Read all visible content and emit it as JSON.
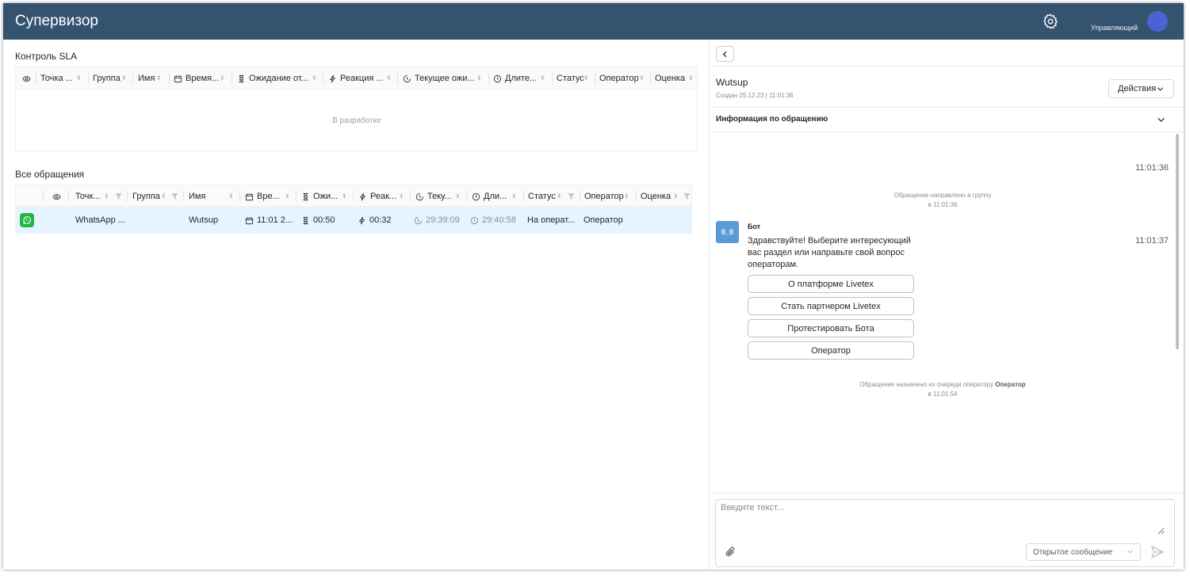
{
  "header": {
    "title": "Супервизор",
    "role": "Управляющий"
  },
  "sla": {
    "title": "Контроль SLA",
    "columns": [
      "Точка ...",
      "Группа",
      "Имя",
      "Время...",
      "Ожидание от...",
      "Реакция ...",
      "Текущее ожи...",
      "Длите...",
      "Статус",
      "Оператор",
      "Оценка"
    ],
    "empty_text": "В разработке"
  },
  "all": {
    "title": "Все обращения",
    "columns": [
      "Точк...",
      "Группа",
      "Имя",
      "Вре...",
      "Ожи...",
      "Реак...",
      "Теку...",
      "Дли...",
      "Статус",
      "Оператор",
      "Оценка"
    ],
    "rows": [
      {
        "channel": "WhatsApp ...",
        "group": "",
        "name": "Wutsup",
        "time": "11:01 2...",
        "wait": "00:50",
        "reaction": "00:32",
        "current": "29:39:09",
        "duration": "29:40:58",
        "status": "На операт...",
        "operator": "Оператор",
        "rating": ""
      }
    ]
  },
  "detail": {
    "client_name": "Wutsup",
    "created": "Создан 25.12.23 | 11:01:36",
    "actions_label": "Действия",
    "info_title": "Информация по обращению"
  },
  "chat": {
    "ts1": "11:01:36",
    "sys1_line1": "Обращение направлено в группу",
    "sys1_line2": "в 11:01:36",
    "bot_avatar": "0_0",
    "bot_name": "Бот",
    "bot_message": "Здравствуйте! Выберите интересующий вас раздел или направьте свой вопрос операторам.",
    "ts2": "11:01:37",
    "quick_replies": [
      "О платформе Livetex",
      "Стать партнером Livetex",
      "Протестировать Бота",
      "Оператор"
    ],
    "sys2_prefix": "Обращение назначено из очереди оператору ",
    "sys2_operator": "Оператор",
    "sys2_line2": "в 11:01:54"
  },
  "composer": {
    "placeholder": "Введите текст...",
    "message_type": "Открытое сообщение"
  }
}
